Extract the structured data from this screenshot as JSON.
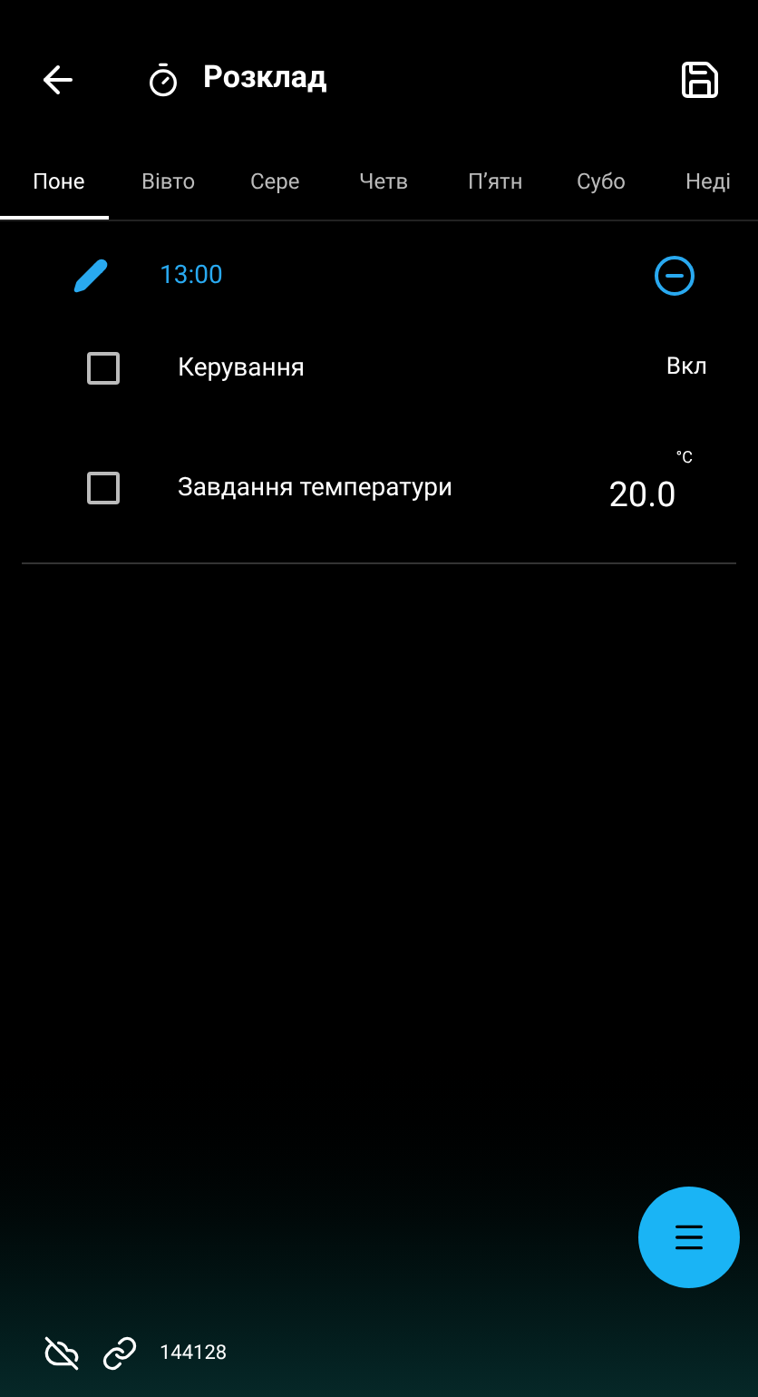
{
  "header": {
    "title": "Розклад"
  },
  "tabs": [
    {
      "label": "Поне",
      "selected": true
    },
    {
      "label": "Вівто",
      "selected": false
    },
    {
      "label": "Сере",
      "selected": false
    },
    {
      "label": "Четв",
      "selected": false
    },
    {
      "label": "П’ятн",
      "selected": false
    },
    {
      "label": "Субо",
      "selected": false
    },
    {
      "label": "Неді",
      "selected": false
    }
  ],
  "schedule": {
    "time": "13:00",
    "rows": [
      {
        "kind": "text",
        "label": "Керування",
        "checked": false,
        "value": "Вкл"
      },
      {
        "kind": "number",
        "label": "Завдання температури",
        "checked": false,
        "value": "20.0",
        "unit": "°C"
      }
    ]
  },
  "status_bar": {
    "id": "144128"
  }
}
